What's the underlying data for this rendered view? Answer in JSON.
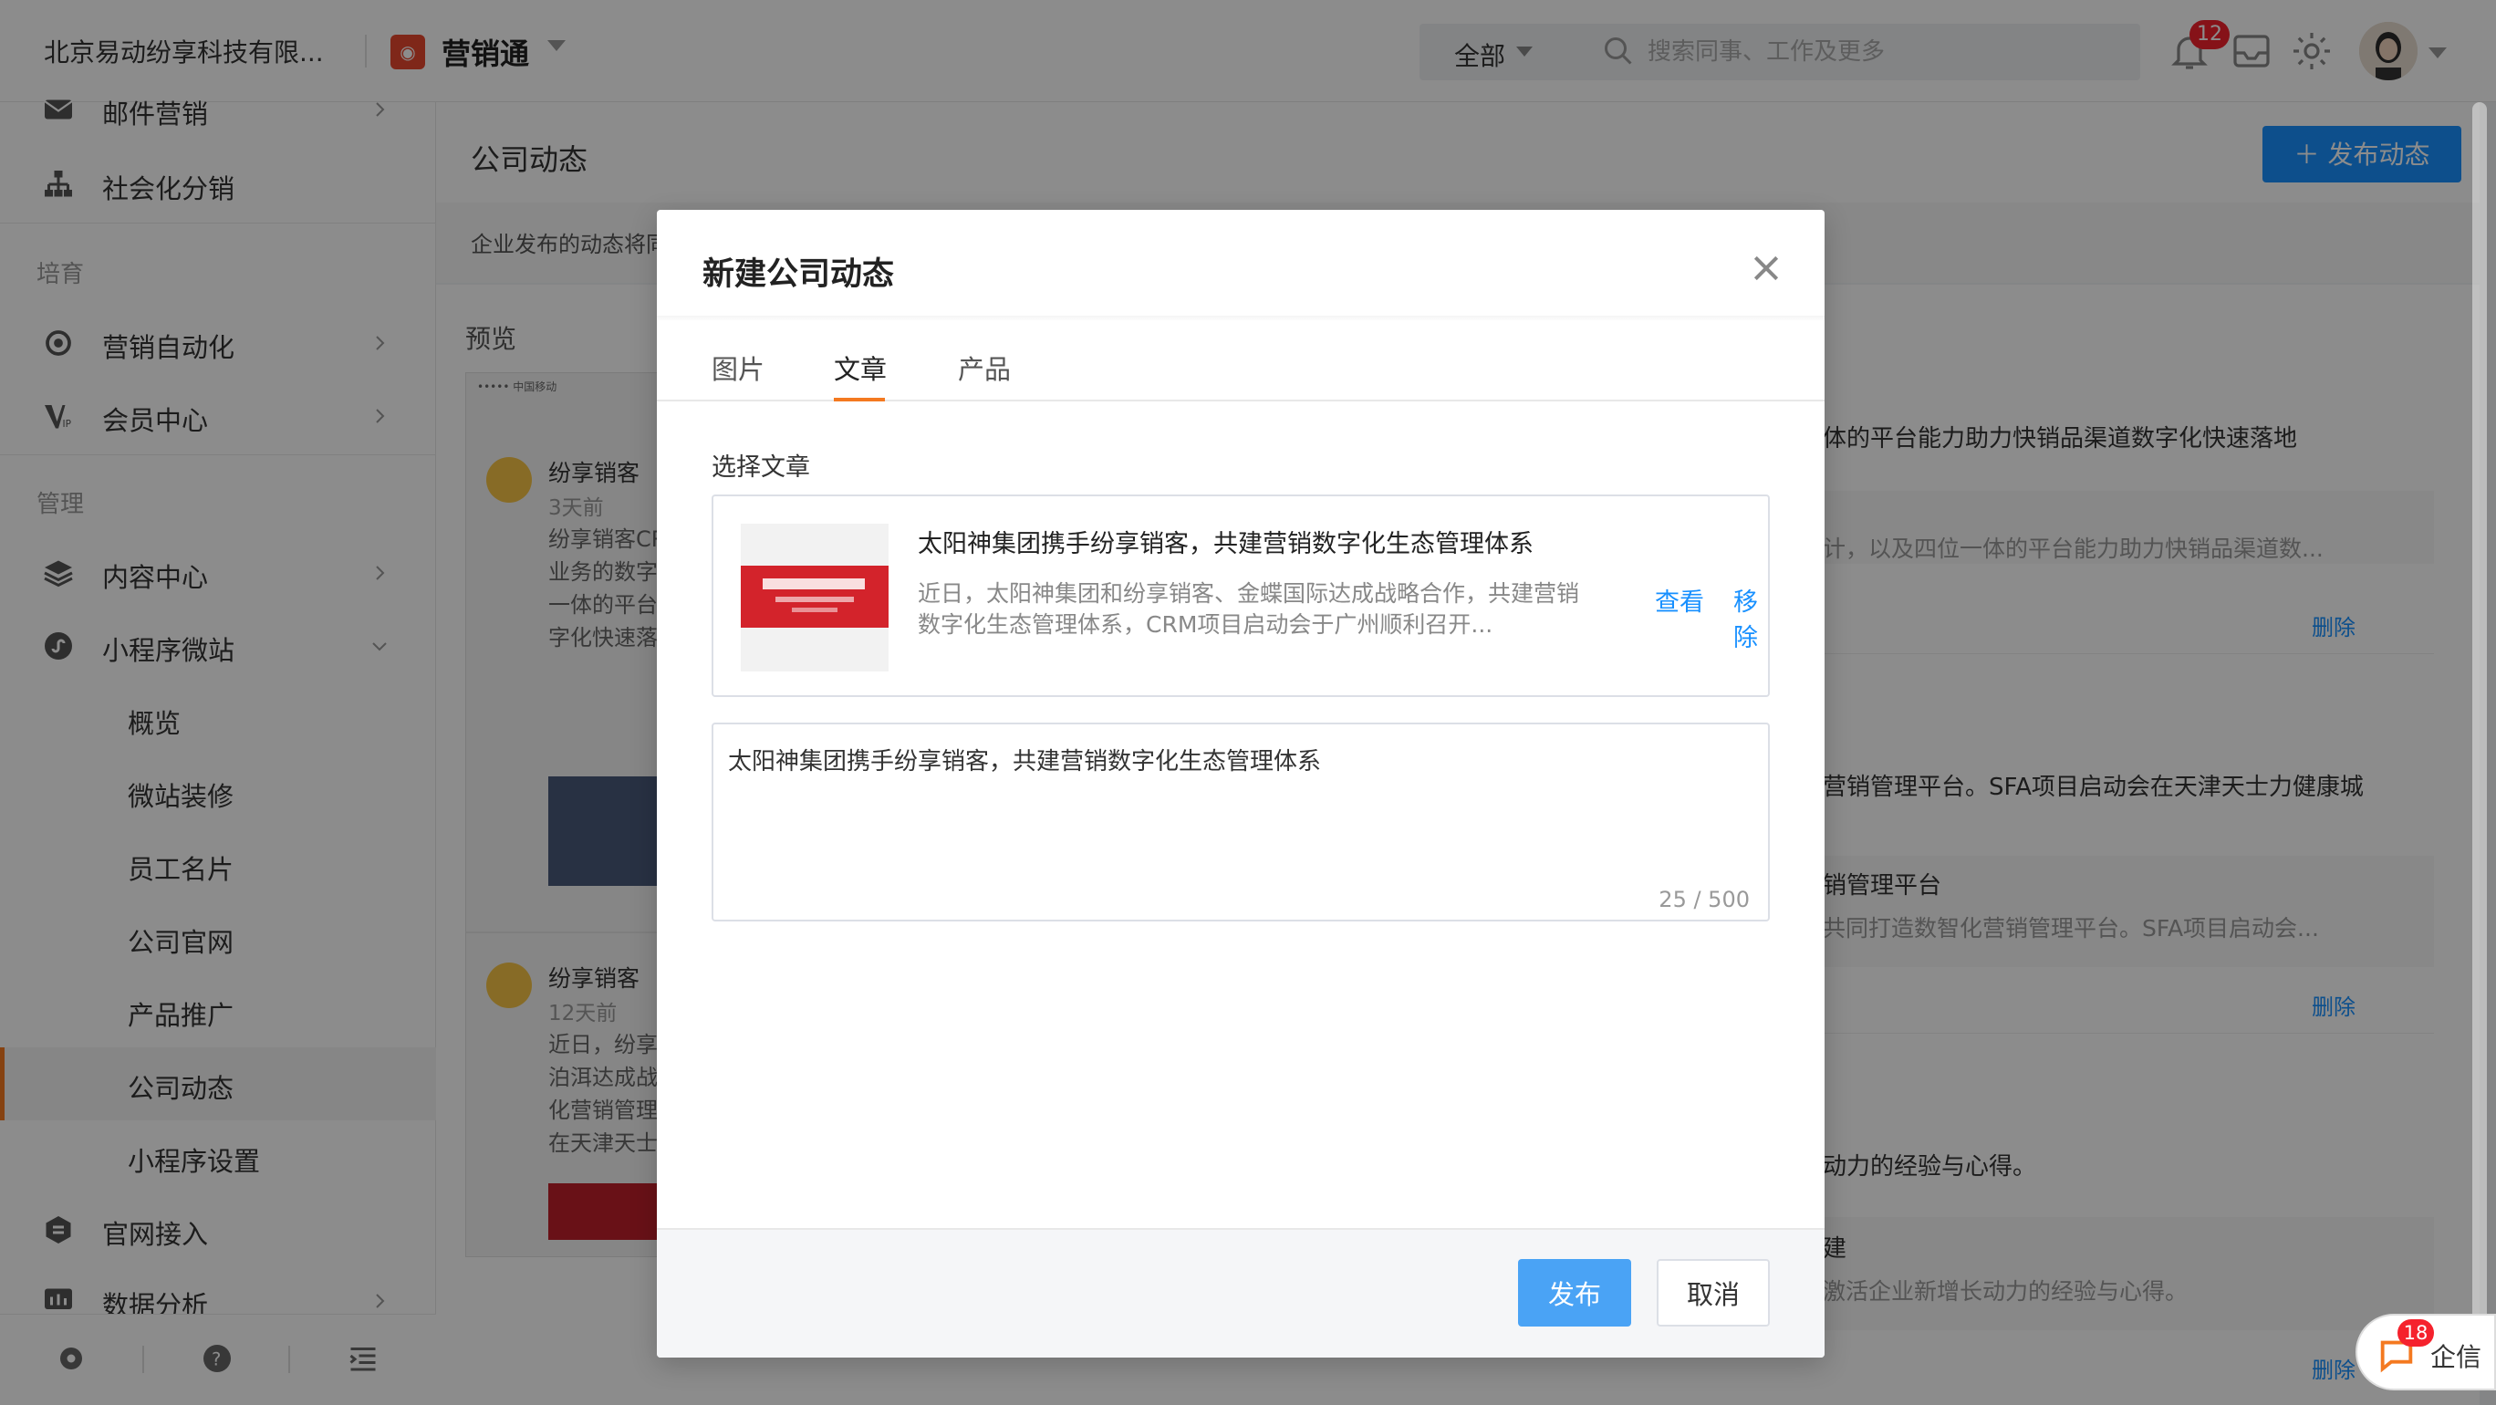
{
  "header": {
    "company": "北京易动纷享科技有限...",
    "app_name": "营销通",
    "scope": "全部",
    "search_placeholder": "搜索同事、工作及更多",
    "bell_count": "12"
  },
  "sidebar": {
    "items": [
      {
        "label": "邮件营销",
        "icon": "mail-icon"
      },
      {
        "label": "社会化分销",
        "icon": "org-tree-icon"
      },
      {
        "section": "培育"
      },
      {
        "label": "营销自动化",
        "icon": "automation-icon"
      },
      {
        "label": "会员中心",
        "icon": "vip-icon"
      },
      {
        "section": "管理"
      },
      {
        "label": "内容中心",
        "icon": "layers-icon"
      },
      {
        "label": "小程序微站",
        "icon": "mini-program-icon"
      }
    ],
    "sub_items": [
      "概览",
      "微站装修",
      "员工名片",
      "公司官网",
      "产品推广",
      "公司动态",
      "小程序设置"
    ],
    "bottom_items": [
      {
        "label": "官网接入",
        "icon": "website-icon"
      },
      {
        "label": "数据分析",
        "icon": "chart-icon"
      }
    ],
    "section_training": "培育",
    "section_manage": "管理"
  },
  "main": {
    "title": "公司动态",
    "publish_button": "发布动态",
    "notice": "企业发布的动态将同",
    "preview_label": "预览",
    "phone_status": "••••• 中国移动",
    "feed": [
      {
        "name": "纷享销客",
        "time": "3天前",
        "text": "纷享销客CR\n业务的数字\n一体的平台\n字化快速落"
      },
      {
        "name": "纷享销客",
        "time": "12天前",
        "text": "近日，纷享\n泊洱达成战\n化营销管理\n在天津天士"
      }
    ],
    "right": {
      "line1": "体的平台能力助力快销品渠道数字化快速落地",
      "card1_desc": "计，以及四位一体的平台能力助力快销品渠道数...",
      "delete": "删除",
      "line2": "营销管理平台。SFA项目启动会在天津天士力健康城",
      "card2_title": "销管理平台",
      "card2_desc": "共同打造数智化营销管理平台。SFA项目启动会...",
      "line3": "动力的经验与心得。",
      "card3_title": "建",
      "card3_desc": "激活企业新增长动力的经验与心得。"
    }
  },
  "modal": {
    "title": "新建公司动态",
    "tabs": [
      "图片",
      "文章",
      "产品"
    ],
    "active_tab": 1,
    "select_label": "选择文章",
    "article": {
      "title": "太阳神集团携手纷享销客，共建营销数字化生态管理体系",
      "desc": "近日，太阳神集团和纷享销客、金蝶国际达成战略合作，共建营销数字化生态管理体系，CRM项目启动会于广州顺利召开...",
      "view": "查看",
      "remove": "移除"
    },
    "content": "太阳神集团携手纷享销客，共建营销数字化生态管理体系",
    "counter": "25 / 500",
    "submit": "发布",
    "cancel": "取消"
  },
  "chat": {
    "badge": "18",
    "label": "企信"
  },
  "colors": {
    "accent": "#1890ff",
    "tab_active": "#f47920",
    "badge": "#f5222d",
    "brand": "#e8482f"
  }
}
